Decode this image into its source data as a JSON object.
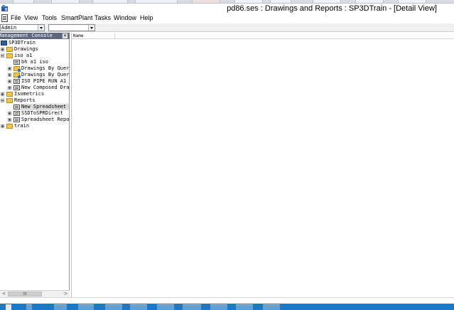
{
  "window": {
    "title": "pd86.ses : Drawings and Reports : SP3DTrain - [Detail View]"
  },
  "menu": {
    "items": [
      "File",
      "View",
      "Tools",
      "SmartPlant",
      "Tasks",
      "Window",
      "Help"
    ]
  },
  "toolbar": {
    "combo1_value": "Admin",
    "combo2_value": ""
  },
  "console": {
    "title": "Management Console",
    "close_glyph": "×"
  },
  "tree": {
    "nodes": [
      {
        "label": "SP3DTrain",
        "icon": "database-root-icon",
        "expander": "none",
        "selected": false
      },
      {
        "label": "Drawings",
        "icon": "folder-icon",
        "expander": "plus",
        "selected": false
      },
      {
        "label": "iso a1",
        "icon": "folder-icon",
        "expander": "minus",
        "selected": false
      },
      {
        "label": "bh a1 iso",
        "icon": "drawing-document-icon",
        "expander": "none",
        "selected": false
      },
      {
        "label": "Drawings By Query",
        "icon": "query-folder-icon",
        "expander": "plus",
        "selected": false
      },
      {
        "label": "Drawings By Query",
        "icon": "query-folder-icon",
        "expander": "plus",
        "selected": false
      },
      {
        "label": "ISO PIPE RUN A1",
        "icon": "drawing-document-icon",
        "expander": "plus",
        "selected": false
      },
      {
        "label": "New Composed Drawi",
        "icon": "drawing-document-icon",
        "expander": "plus",
        "selected": false
      },
      {
        "label": "Isometrics",
        "icon": "folder-icon",
        "expander": "plus",
        "selected": false
      },
      {
        "label": "Reports",
        "icon": "folder-icon",
        "expander": "minus",
        "selected": false
      },
      {
        "label": "New Spreadsheet Re",
        "icon": "spreadsheet-report-icon",
        "expander": "none",
        "selected": true
      },
      {
        "label": "SSDToSPRDirect",
        "icon": "spreadsheet-report-icon",
        "expander": "plus",
        "selected": false
      },
      {
        "label": "Spreadsheet Report",
        "icon": "spreadsheet-report-icon",
        "expander": "plus",
        "selected": false
      },
      {
        "label": "train",
        "icon": "folder-icon",
        "expander": "plus",
        "selected": false
      }
    ]
  },
  "detail": {
    "columns": [
      "Name"
    ]
  },
  "scrollbar": {
    "left_arrow": "<",
    "right_arrow": ">",
    "grip": "III"
  }
}
